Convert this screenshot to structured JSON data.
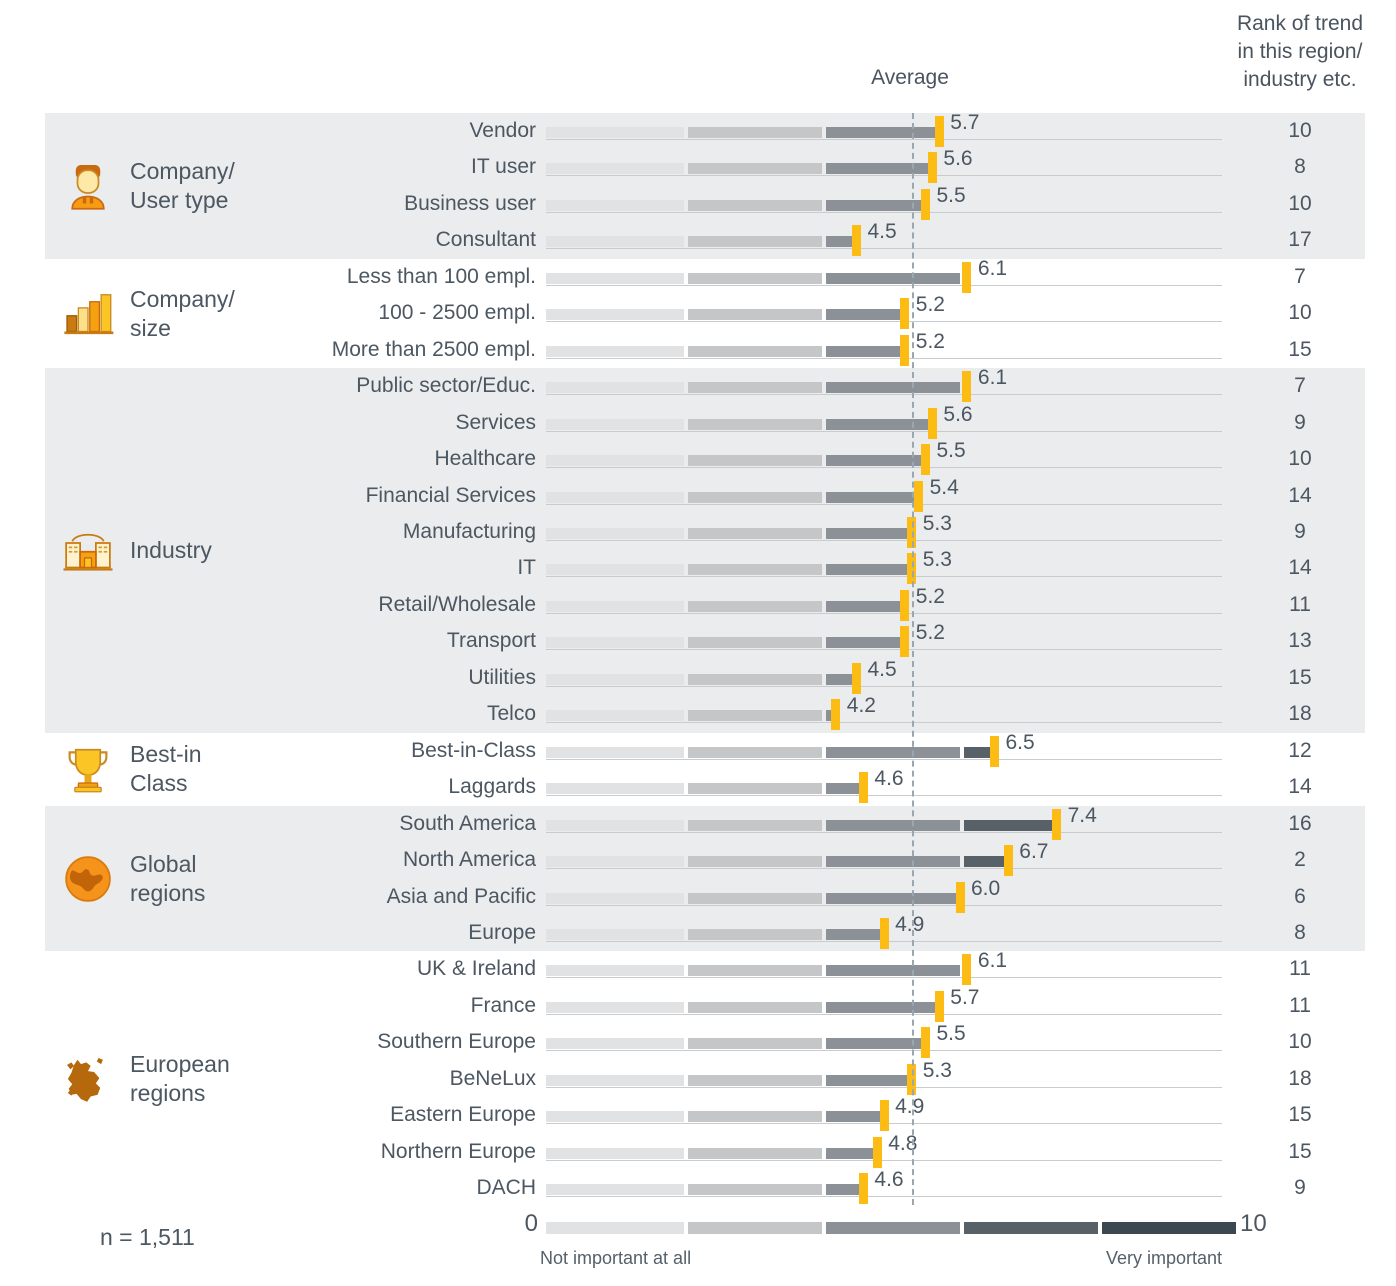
{
  "header": {
    "average_label": "Average",
    "rank_label": "Rank of trend\nin this region/\nindustry etc."
  },
  "footer": {
    "sample_size": "n = 1,511",
    "scale_min": "0",
    "scale_max": "10",
    "scale_low_label": "Not important at all",
    "scale_high_label": "Very important"
  },
  "colors": {
    "marker": "#fcbc14",
    "band": "#eaeced",
    "text": "#4c5762",
    "average_line": "#9aa6b0",
    "segments": [
      "#e0e2e3",
      "#c4c6c8",
      "#8b9196",
      "#586068",
      "#3b4751"
    ]
  },
  "groups": [
    {
      "title": "Company/\nUser type",
      "icon": "person-icon",
      "shaded": true,
      "rows": [
        0,
        1,
        2,
        3
      ]
    },
    {
      "title": "Company/\nsize",
      "icon": "bar-chart-icon",
      "shaded": false,
      "rows": [
        4,
        5,
        6
      ]
    },
    {
      "title": "Industry",
      "icon": "factory-icon",
      "shaded": true,
      "rows": [
        7,
        8,
        9,
        10,
        11,
        12,
        13,
        14,
        15,
        16
      ]
    },
    {
      "title": "Best-in\nClass",
      "icon": "trophy-icon",
      "shaded": false,
      "rows": [
        17,
        18
      ]
    },
    {
      "title": "Global\nregions",
      "icon": "globe-icon",
      "shaded": true,
      "rows": [
        19,
        20,
        21,
        22
      ]
    },
    {
      "title": "European\nregions",
      "icon": "europe-map-icon",
      "shaded": false,
      "rows": [
        23,
        24,
        25,
        26,
        27,
        28,
        29
      ]
    }
  ],
  "chart_data": {
    "type": "bar",
    "title": "",
    "subtitle": "",
    "xlabel": "",
    "ylabel": "",
    "xlim": [
      0,
      10
    ],
    "grid": true,
    "legend": "none",
    "average_line_value": 5.45,
    "axis_low_label": "Not important at all",
    "axis_high_label": "Very important",
    "rank_column_header": "Rank of trend in this region/ industry etc.",
    "value_column_header": "Average",
    "categories": [
      "Vendor",
      "IT user",
      "Business user",
      "Consultant",
      "Less than 100 empl.",
      "100 - 2500 empl.",
      "More than 2500 empl.",
      "Public sector/Educ.",
      "Services",
      "Healthcare",
      "Financial Services",
      "Manufacturing",
      "IT",
      "Retail/Wholesale",
      "Transport",
      "Utilities",
      "Telco",
      "Best-in-Class",
      "Laggards",
      "South America",
      "North America",
      "Asia and Pacific",
      "Europe",
      "UK & Ireland",
      "France",
      "Southern Europe",
      "BeNeLux",
      "Eastern Europe",
      "Northern Europe",
      "DACH"
    ],
    "values": [
      5.7,
      5.6,
      5.5,
      4.5,
      6.1,
      5.2,
      5.2,
      6.1,
      5.6,
      5.5,
      5.4,
      5.3,
      5.3,
      5.2,
      5.2,
      4.5,
      4.2,
      6.5,
      4.6,
      7.4,
      6.7,
      6.0,
      4.9,
      6.1,
      5.7,
      5.5,
      5.3,
      4.9,
      4.8,
      4.6
    ],
    "value_labels": [
      "5.7",
      "5.6",
      "5.5",
      "4.5",
      "6.1",
      "5.2",
      "5.2",
      "6.1",
      "5.6",
      "5.5",
      "5.4",
      "5.3",
      "5.3",
      "5.2",
      "5.2",
      "4.5",
      "4.2",
      "6.5",
      "4.6",
      "7.4",
      "6.7",
      "6.0",
      "4.9",
      "6.1",
      "5.7",
      "5.5",
      "5.3",
      "4.9",
      "4.8",
      "4.6"
    ],
    "ranks": [
      "10",
      "8",
      "10",
      "17",
      "7",
      "10",
      "15",
      "7",
      "9",
      "10",
      "14",
      "9",
      "14",
      "11",
      "13",
      "15",
      "18",
      "12",
      "14",
      "16",
      "2",
      "6",
      "8",
      "11",
      "11",
      "10",
      "18",
      "15",
      "15",
      "9"
    ]
  }
}
